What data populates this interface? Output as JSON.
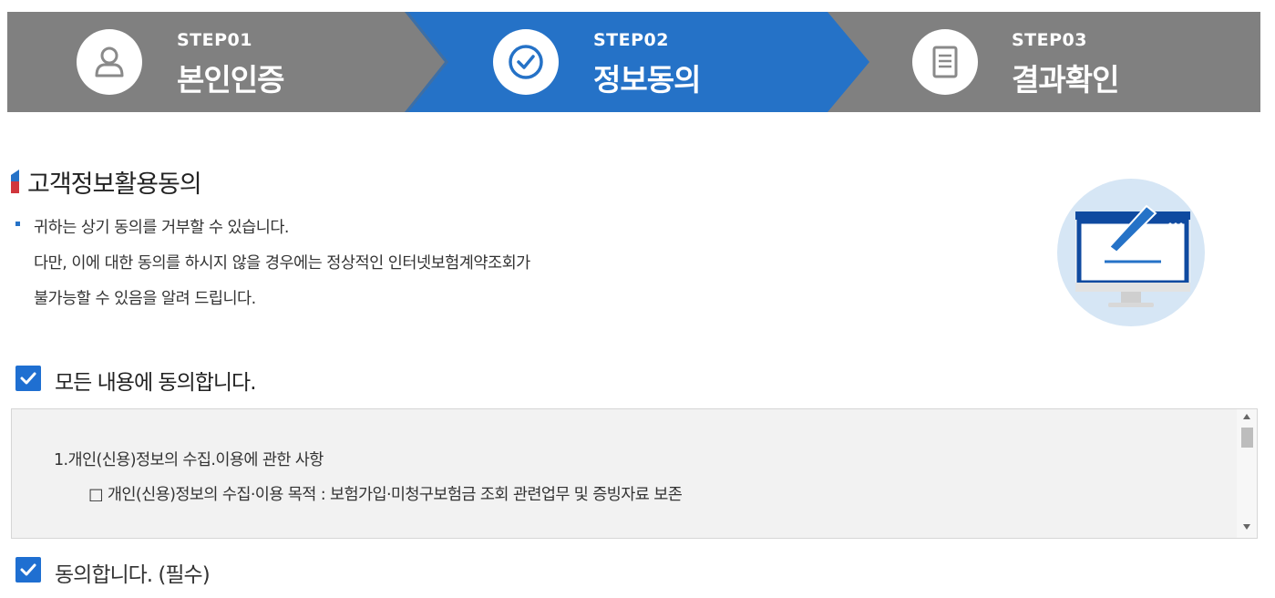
{
  "steps": [
    {
      "num": "STEP01",
      "title": "본인인증",
      "icon": "person-icon",
      "active": false
    },
    {
      "num": "STEP02",
      "title": "정보동의",
      "icon": "check-circle-icon",
      "active": true
    },
    {
      "num": "STEP03",
      "title": "결과확인",
      "icon": "document-icon",
      "active": false
    }
  ],
  "colors": {
    "accent": "#2572c7",
    "inactive": "#808080",
    "checkbox": "#1f6fd1"
  },
  "section": {
    "title": "고객정보활용동의",
    "desc": [
      "귀하는 상기 동의를 거부할 수 있습니다.",
      "다만, 이에 대한 동의를 하시지 않을 경우에는 정상적인 인터넷보험계약조회가",
      "불가능할 수 있음을 알려 드립니다."
    ],
    "illustration": "monitor-pen-icon"
  },
  "agree_all": {
    "label": "모든 내용에 동의합니다.",
    "checked": true
  },
  "terms": {
    "line1": "1.개인(신용)정보의 수집.이용에 관한 사항",
    "line2": "□ 개인(신용)정보의 수집·이용 목적 : 보험가입·미청구보험금 조회 관련업무 및 증빙자료 보존"
  },
  "agree_required": {
    "label": "동의합니다. (필수)",
    "checked": true
  }
}
